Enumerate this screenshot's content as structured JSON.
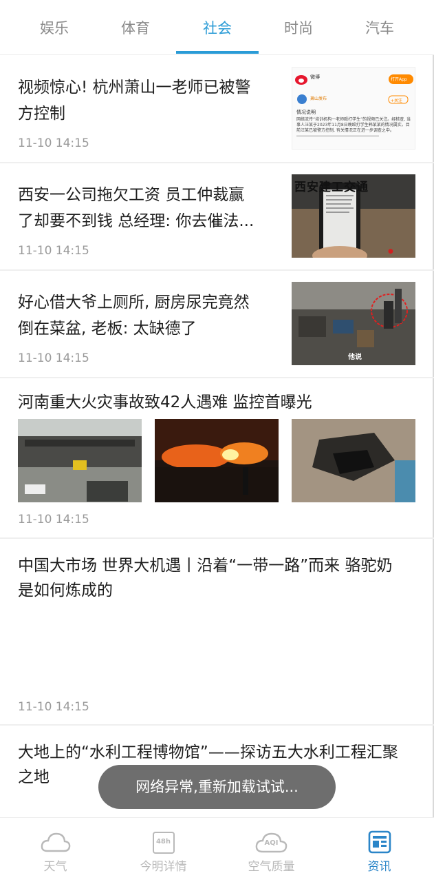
{
  "tabs": [
    {
      "label": "娱乐"
    },
    {
      "label": "体育"
    },
    {
      "label": "社会",
      "active": true
    },
    {
      "label": "时尚"
    },
    {
      "label": "汽车"
    }
  ],
  "news": [
    {
      "title_l1": "视频惊心! 杭州萧山一老师已被警",
      "title_l2": "方控制",
      "time": "11-10 14:15",
      "thumb_text": {
        "app": "微博",
        "btn": "打开App",
        "account": "萧山发布",
        "follow": "+关注",
        "heading": "情况说明",
        "body": "网络流传“培训机构一老师殴打学生”的视频已关注。经核查, 当事人汪某于2023年11月8日晚殴打学生韩某某的情况属实。目前汪某已被警方控制, 有关情况正在进一步调查之中。"
      }
    },
    {
      "title_l1": "西安一公司拖欠工资 员工仲裁赢",
      "title_l2": "了却要不到钱 总经理: 你去催法...",
      "time": "11-10 14:15",
      "thumb_text": {
        "sign": "西安建工交通"
      }
    },
    {
      "title_l1": "好心借大爷上厕所, 厨房尿完竟然",
      "title_l2": "倒在菜盆, 老板: 太缺德了",
      "time": "11-10 14:15",
      "thumb_text": {
        "caption": "他说"
      }
    },
    {
      "title_l1": "河南重大火灾事故致42人遇难 监控首曝光",
      "time": "11-10 14:15"
    },
    {
      "title_l1": "中国大市场 世界大机遇丨沿着“一带一路”而来 骆驼奶",
      "title_l2": "是如何炼成的",
      "time": "11-10 14:15"
    },
    {
      "title_l1": "大地上的“水利工程博物馆”——探访五大水利工程汇聚",
      "title_l2": "之地"
    }
  ],
  "toast": "网络异常,重新加载试试...",
  "bottom_nav": [
    {
      "label": "天气",
      "icon": "cloud-icon"
    },
    {
      "label": "今明详情",
      "icon": "48h-icon",
      "icon_text": "48h"
    },
    {
      "label": "空气质量",
      "icon": "aqi-icon",
      "icon_text": "AQI"
    },
    {
      "label": "资讯",
      "icon": "news-icon",
      "active": true
    }
  ],
  "colors": {
    "accent": "#2a9bd6",
    "active_nav": "#2a85c8",
    "muted": "#9a9a9a"
  }
}
